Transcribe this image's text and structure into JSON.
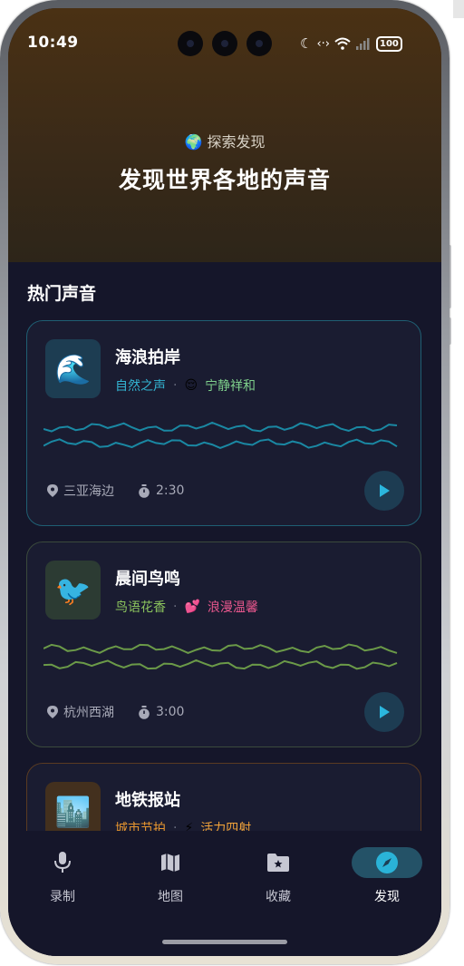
{
  "status_bar": {
    "time": "10:49",
    "battery": "100",
    "icons": [
      "moon-icon",
      "signal-arrows-icon",
      "wifi-icon",
      "cellular-icon",
      "battery-icon"
    ]
  },
  "hero": {
    "kicker_icon": "🌍",
    "kicker": "探索发现",
    "title": "发现世界各地的声音"
  },
  "section": {
    "title": "热门声音"
  },
  "cards": [
    {
      "emoji": "🌊",
      "title": "海浪拍岸",
      "category": "自然之声",
      "mood_emoji": "😌",
      "mood": "宁静祥和",
      "location": "三亚海边",
      "duration": "2:30",
      "accent": "#1a88a3",
      "category_color": "#33b3d1",
      "mood_color": "#7fd08c",
      "border": "#1f5f73",
      "thumb_bg": "#1d3d52"
    },
    {
      "emoji": "🐦",
      "title": "晨间鸟鸣",
      "category": "鸟语花香",
      "mood_emoji": "💕",
      "mood": "浪漫温馨",
      "location": "杭州西湖",
      "duration": "3:00",
      "accent": "#6b9a48",
      "category_color": "#8bc35d",
      "mood_color": "#e8578d",
      "border": "#3b4a3c",
      "thumb_bg": "#2c3b33"
    },
    {
      "emoji": "🏙️",
      "title": "地铁报站",
      "category": "城市节拍",
      "mood_emoji": "⚡",
      "mood": "活力四射",
      "accent": "#e08a2a",
      "category_color": "#e6952f",
      "mood_color": "#f0a23a",
      "border": "#5a3b22",
      "thumb_bg": "#43301e"
    }
  ],
  "nav": [
    {
      "label": "录制",
      "icon": "microphone-icon"
    },
    {
      "label": "地图",
      "icon": "map-icon"
    },
    {
      "label": "收藏",
      "icon": "folder-star-icon"
    },
    {
      "label": "发现",
      "icon": "compass-icon",
      "active": true
    }
  ]
}
